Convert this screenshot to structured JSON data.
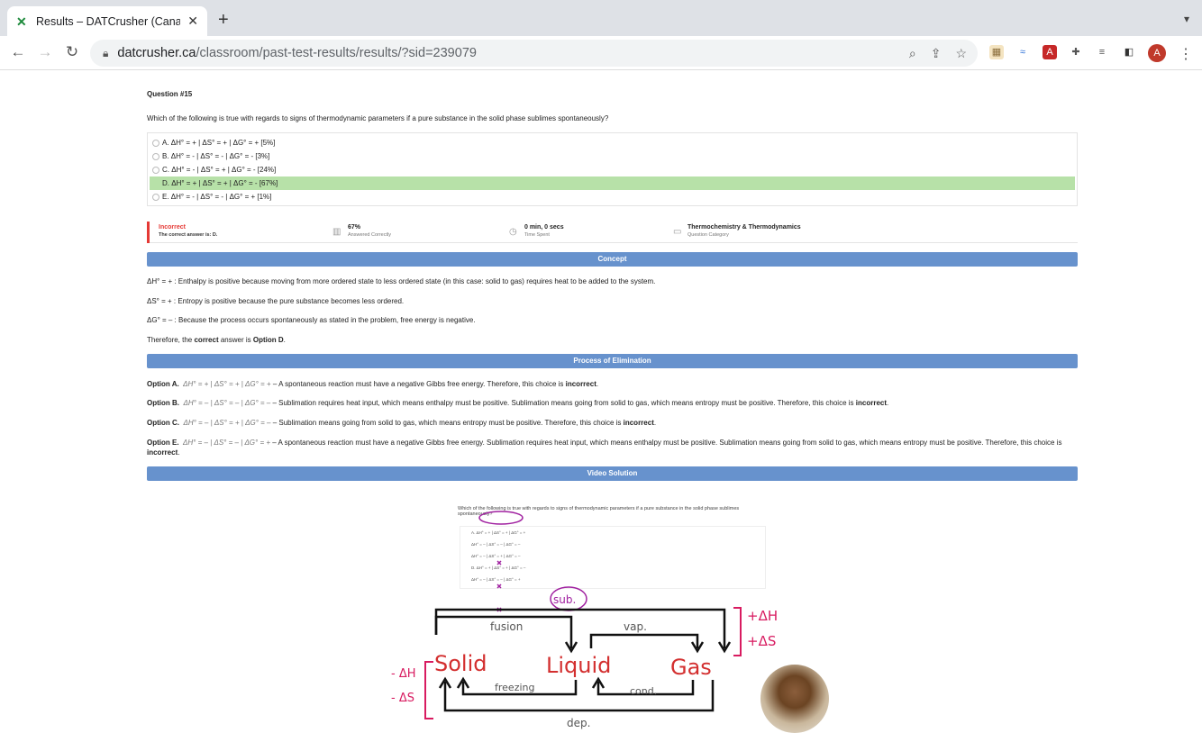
{
  "browser": {
    "tab_title": "Results – DATCrusher (Canadia",
    "url_host": "datcrusher.ca",
    "url_path": "/classroom/past-test-results/results/?sid=239079",
    "avatar_letter": "A"
  },
  "question": {
    "number_label": "Question #15",
    "text": "Which of the following is true with regards to signs of thermodynamic parameters if a pure substance in the solid phase sublimes spontaneously?",
    "choices": [
      {
        "label": "A. ΔH° = + | ΔS° = + | ΔG° = + [5%]",
        "correct": false
      },
      {
        "label": "B. ΔH° = - | ΔS° = - | ΔG° = - [3%]",
        "correct": false
      },
      {
        "label": "C. ΔH° = - | ΔS° = + | ΔG° = - [24%]",
        "correct": false
      },
      {
        "label": "D. ΔH° = + | ΔS° = + | ΔG° = - [67%]",
        "correct": true
      },
      {
        "label": "E. ΔH° = - | ΔS° = - | ΔG° = + [1%]",
        "correct": false
      }
    ]
  },
  "stats": {
    "result": "Incorrect",
    "correct_answer": "The correct answer is: D.",
    "percent": "67%",
    "percent_label": "Answered Correctly",
    "time": "0 min, 0 secs",
    "time_label": "Time Spent",
    "category": "Thermochemistry & Thermodynamics",
    "category_label": "Question Category"
  },
  "concept": {
    "header": "Concept",
    "p1": "ΔH° = + : Enthalpy is positive because moving from more ordered state to less ordered state (in this case: solid to gas) requires heat to be added to the system.",
    "p2": "ΔS° = + : Entropy is positive because the pure substance becomes less ordered.",
    "p3": "ΔG° = – : Because the process occurs spontaneously as stated in the problem, free energy is negative.",
    "p4_pre": "Therefore, the ",
    "p4_bold1": "correct",
    "p4_mid": " answer is ",
    "p4_bold2": "Option D",
    "p4_end": "."
  },
  "elimination": {
    "header": "Process of Elimination",
    "items": [
      {
        "opt": "Option A.",
        "formula": "ΔH° = + | ΔS° = + | ΔG° = +",
        "text": " – A spontaneous reaction must have a negative Gibbs free energy. Therefore, this choice is ",
        "verdict": "incorrect",
        "end": "."
      },
      {
        "opt": "Option B.",
        "formula": "ΔH° = – | ΔS° = – | ΔG° = –",
        "text": " – Sublimation requires heat input, which means enthalpy must be positive. Sublimation means going from solid to gas, which means entropy must be positive. Therefore, this choice is ",
        "verdict": "incorrect",
        "end": "."
      },
      {
        "opt": "Option C.",
        "formula": "ΔH° = – | ΔS° = + | ΔG° = –",
        "text": " – Sublimation means going from solid to gas, which means entropy must be positive. Therefore, this choice is ",
        "verdict": "incorrect",
        "end": "."
      },
      {
        "opt": "Option E.",
        "formula": "ΔH° = – | ΔS° = – | ΔG° = +",
        "text": " – A spontaneous reaction must have a negative Gibbs free energy. Sublimation requires heat input, which means enthalpy must be positive. Sublimation means going from solid to gas, which means entropy must be positive. Therefore, this choice is ",
        "verdict": "incorrect",
        "end": "."
      }
    ]
  },
  "video": {
    "header": "Video Solution",
    "question": "Which of the following is true with regards to signs of thermodynamic parameters if a pure substance in the solid phase sublimes spontaneously?",
    "choices": [
      "A. ΔH° = + | ΔS° = + | ΔG° = +",
      "ΔH° = – | ΔS° = – | ΔG° = –",
      "ΔH° = – | ΔS° = + | ΔG° = –",
      "D. ΔH° = + | ΔS° = + | ΔG° = –",
      "ΔH° = – | ΔS° = – | ΔG° = +"
    ],
    "sub": "sub.",
    "fusion": "fusion",
    "vap": "vap.",
    "solid": "Solid",
    "liquid": "Liquid",
    "gas": "Gas",
    "freezing": "freezing",
    "cond": "cond.",
    "dep": "dep.",
    "plus_dh": "+ΔH",
    "plus_ds": "+ΔS",
    "minus_dh": "- ΔH",
    "minus_ds": "- ΔS"
  }
}
